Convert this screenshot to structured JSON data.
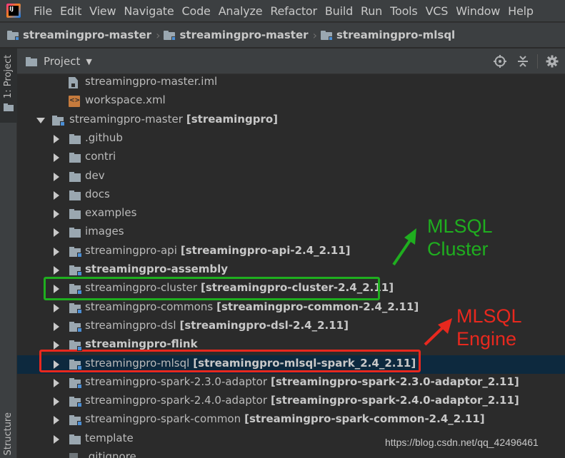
{
  "menubar": {
    "logo_text": "IJ",
    "items": [
      "File",
      "Edit",
      "View",
      "Navigate",
      "Code",
      "Analyze",
      "Refactor",
      "Build",
      "Run",
      "Tools",
      "VCS",
      "Window",
      "Help"
    ]
  },
  "breadcrumbs": [
    "streamingpro-master",
    "streamingpro-master",
    "streamingpro-mlsql"
  ],
  "left_strip": {
    "project_tab": "1: Project",
    "structure_tab": "Structure"
  },
  "panel": {
    "title": "Project",
    "caret": "▼",
    "tools": [
      "locate-icon",
      "collapse-icon",
      "gear-icon"
    ]
  },
  "tree": [
    {
      "label": "streamingpro-master.iml",
      "icon": "file"
    },
    {
      "label": "workspace.xml",
      "icon": "xml"
    },
    {
      "label": "streamingpro-master",
      "module": "[streamingpro]",
      "icon": "module",
      "expanded": true
    },
    {
      "label": ".github",
      "icon": "folder"
    },
    {
      "label": "contri",
      "icon": "folder"
    },
    {
      "label": "dev",
      "icon": "folder"
    },
    {
      "label": "docs",
      "icon": "folder"
    },
    {
      "label": "examples",
      "icon": "folder"
    },
    {
      "label": "images",
      "icon": "folder"
    },
    {
      "label": "streamingpro-api",
      "module": "[streamingpro-api-2.4_2.11]",
      "icon": "module"
    },
    {
      "label": "streamingpro-assembly",
      "icon": "module",
      "bold": true
    },
    {
      "label": "streamingpro-cluster",
      "module": "[streamingpro-cluster-2.4_2.11]",
      "icon": "module"
    },
    {
      "label": "streamingpro-commons",
      "module": "[streamingpro-common-2.4_2.11]",
      "icon": "module"
    },
    {
      "label": "streamingpro-dsl",
      "module": "[streamingpro-dsl-2.4_2.11]",
      "icon": "module"
    },
    {
      "label": "streamingpro-flink",
      "icon": "module",
      "bold": true
    },
    {
      "label": "streamingpro-mlsql",
      "module": "[streamingpro-mlsql-spark_2.4_2.11]",
      "icon": "module",
      "selected": true
    },
    {
      "label": "streamingpro-spark-2.3.0-adaptor",
      "module": "[streamingpro-spark-2.3.0-adaptor_2.11]",
      "icon": "module"
    },
    {
      "label": "streamingpro-spark-2.4.0-adaptor",
      "module": "[streamingpro-spark-2.4.0-adaptor_2.11]",
      "icon": "module"
    },
    {
      "label": "streamingpro-spark-common",
      "module": "[streamingpro-spark-common-2.4_2.11]",
      "icon": "module"
    },
    {
      "label": "template",
      "icon": "folder"
    },
    {
      "label": ".gitignore",
      "icon": "git"
    }
  ],
  "annotations": {
    "cluster_line1": "MLSQL",
    "cluster_line2": "Cluster",
    "engine_line1": "MLSQL",
    "engine_line2": "Engine",
    "green": "#1fae1f",
    "red": "#e8281e"
  },
  "watermark": "https://blog.csdn.net/qq_42496461"
}
